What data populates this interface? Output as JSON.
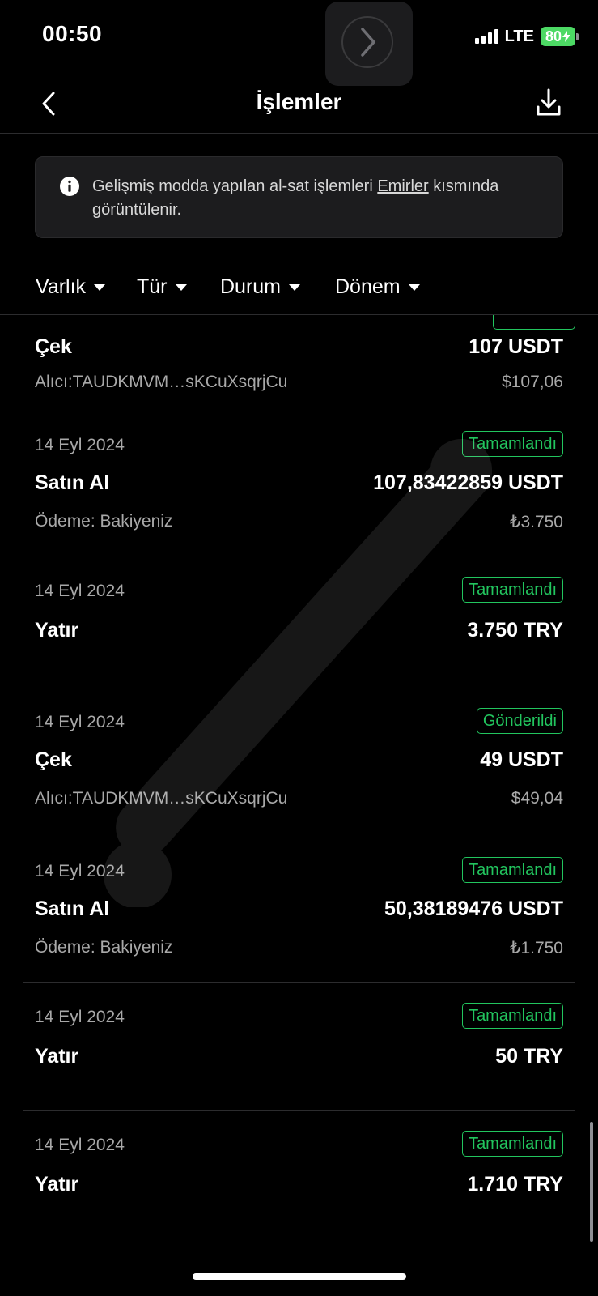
{
  "status_bar": {
    "time": "00:50",
    "network": "LTE",
    "battery": "80"
  },
  "nav": {
    "title": "İşlemler"
  },
  "info": {
    "text_before": "Gelişmiş modda yapılan al-sat işlemleri ",
    "link": "Emirler",
    "text_after": " kısmında görüntülenir."
  },
  "filters": [
    "Varlık",
    "Tür",
    "Durum",
    "Dönem"
  ],
  "transactions": [
    {
      "type": "Çek",
      "amount": "107 USDT",
      "sub": "Alıcı:TAUDKMVM…sKCuXsqrjCu",
      "sub_value": "$107,06"
    },
    {
      "date": "14 Eyl 2024",
      "status": "Tamamlandı",
      "type": "Satın Al",
      "amount": "107,83422859 USDT",
      "sub": "Ödeme: Bakiyeniz",
      "sub_value": "₺3.750"
    },
    {
      "date": "14 Eyl 2024",
      "status": "Tamamlandı",
      "type": "Yatır",
      "amount": "3.750 TRY"
    },
    {
      "date": "14 Eyl 2024",
      "status": "Gönderildi",
      "type": "Çek",
      "amount": "49 USDT",
      "sub": "Alıcı:TAUDKMVM…sKCuXsqrjCu",
      "sub_value": "$49,04"
    },
    {
      "date": "14 Eyl 2024",
      "status": "Tamamlandı",
      "type": "Satın Al",
      "amount": "50,38189476 USDT",
      "sub": "Ödeme: Bakiyeniz",
      "sub_value": "₺1.750"
    },
    {
      "date": "14 Eyl 2024",
      "status": "Tamamlandı",
      "type": "Yatır",
      "amount": "50 TRY"
    },
    {
      "date": "14 Eyl 2024",
      "status": "Tamamlandı",
      "type": "Yatır",
      "amount": "1.710 TRY"
    }
  ],
  "colors": {
    "background": "#000000",
    "status_green": "#22c55e",
    "battery_green": "#4cd964"
  }
}
